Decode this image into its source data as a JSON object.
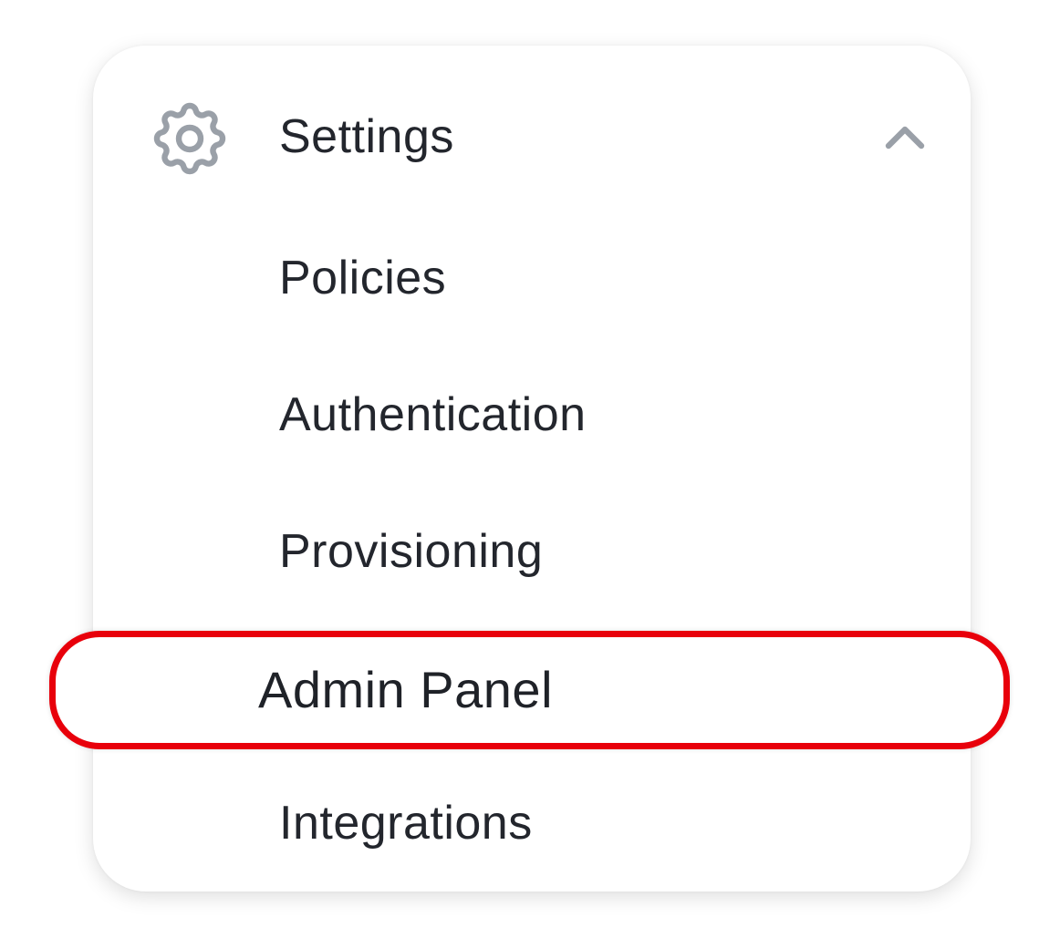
{
  "menu": {
    "header": {
      "label": "Settings",
      "icon": "gear-icon",
      "toggle_icon": "chevron-up-icon",
      "expanded": true
    },
    "items": [
      {
        "label": "Policies"
      },
      {
        "label": "Authentication"
      },
      {
        "label": "Provisioning"
      },
      {
        "label": "Admin Panel",
        "highlighted": true
      },
      {
        "label": "Integrations"
      }
    ]
  },
  "colors": {
    "text": "#23262d",
    "icon": "#9aa0a8",
    "highlight_border": "#e8000b",
    "card_background": "#ffffff"
  }
}
